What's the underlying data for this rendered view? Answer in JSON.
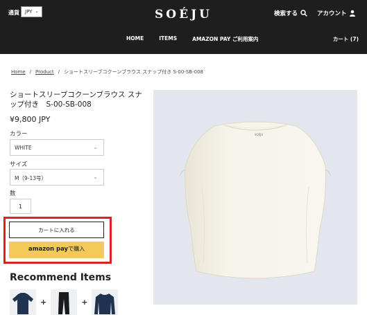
{
  "header": {
    "currency_label": "通貨",
    "currency_value": "JPY",
    "logo": "SOÉJU",
    "search_label": "検索する",
    "account_label": "アカウント",
    "nav": [
      "HOME",
      "ITEMS",
      "AMAZON PAY ご利用案内"
    ],
    "cart_label": "カート (7)"
  },
  "breadcrumb": {
    "home": "Home",
    "product": "Product",
    "current": "ショートスリーブコクーンブラウス スナップ付き S-00-SB-008"
  },
  "product": {
    "title": "ショートスリーブコクーンブラウス スナップ付き　S-00-SB-008",
    "price": "¥9,800 JPY",
    "color_label": "カラー",
    "color_value": "WHITE",
    "size_label": "サイズ",
    "size_value": "M（9-13号）",
    "qty_label": "数",
    "qty_value": "1",
    "add_to_cart": "カートに入れる",
    "amazon_brand": "amazon pay",
    "amazon_suffix": "で購入",
    "shirt_tag": "SOÉJU"
  },
  "recommend": {
    "title": "Recommend Items",
    "plus": "+"
  },
  "colors": {
    "header_bg": "#1e1e1e",
    "amazon_yellow": "#f3c95a",
    "highlight_red": "#e02020",
    "rec_navy": "#1f3350"
  },
  "icons": [
    "chevron-down-icon",
    "search-icon",
    "person-icon",
    "shirt-image",
    "pants-image",
    "sweater-image"
  ]
}
